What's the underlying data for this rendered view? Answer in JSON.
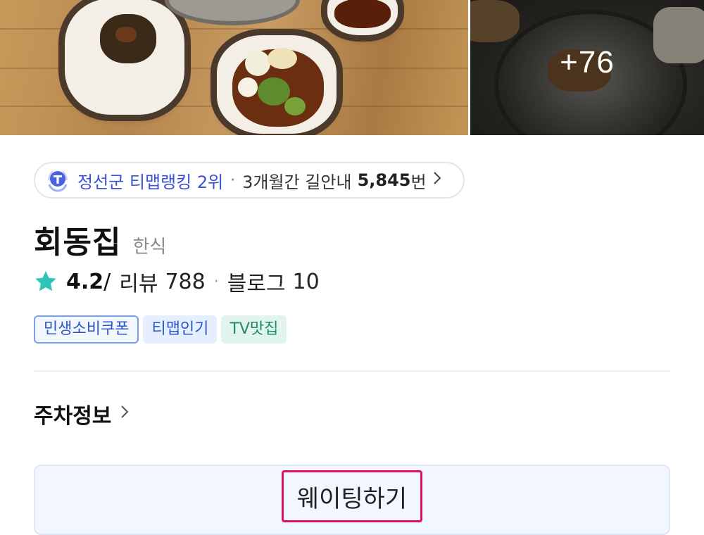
{
  "photos": {
    "more_count": "+76"
  },
  "ranking": {
    "rank_text": "정선군 티맵랭킹 2위",
    "separator": "·",
    "visit_prefix": "3개월간 길안내",
    "visit_count": "5,845",
    "visit_suffix": "번"
  },
  "place": {
    "name": "회동집",
    "category": "한식",
    "rating": "4.2",
    "rating_slash": "/",
    "review_label": "리뷰",
    "review_count": "788",
    "dot": "·",
    "blog_label": "블로그",
    "blog_count": "10"
  },
  "tags": [
    "민생소비쿠폰",
    "티맵인기",
    "TV맛집"
  ],
  "parking": {
    "label": "주차정보"
  },
  "waiting": {
    "button_label": "웨이팅하기"
  },
  "colors": {
    "rank_blue": "#3b52d8",
    "star_teal": "#2cc6b8",
    "highlight_border": "#e0115f"
  }
}
